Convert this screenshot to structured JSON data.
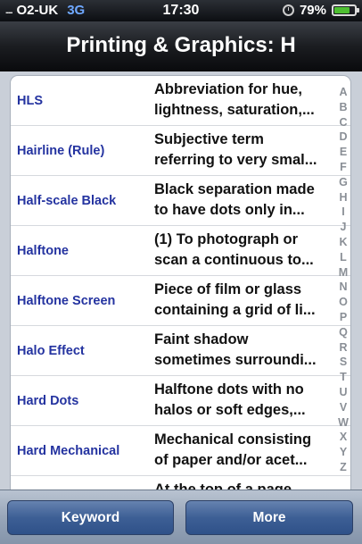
{
  "status_bar": {
    "signal": ".....",
    "carrier": "O2-UK",
    "network": "3G",
    "time": "17:30",
    "battery": "79%",
    "battery_level": 0.79
  },
  "nav": {
    "title": "Printing & Graphics: H"
  },
  "rows": [
    {
      "term": "HLS",
      "def1": "Abbreviation for hue,",
      "def2": "lightness, saturation,..."
    },
    {
      "term": "Hairline (Rule)",
      "def1": "Subjective term",
      "def2": "referring to very smal..."
    },
    {
      "term": "Half-scale Black",
      "def1": "Black separation made",
      "def2": "to have dots only in..."
    },
    {
      "term": "Halftone",
      "def1": "(1) To photograph or",
      "def2": "scan a continuous to..."
    },
    {
      "term": "Halftone Screen",
      "def1": "Piece of film or glass",
      "def2": "containing a grid of li..."
    },
    {
      "term": "Halo Effect",
      "def1": "Faint shadow",
      "def2": "sometimes surroundi..."
    },
    {
      "term": "Hard Dots",
      "def1": "Halftone dots with no",
      "def2": "halos or soft edges,..."
    },
    {
      "term": "Hard Mechanical",
      "def1": "Mechanical consisting",
      "def2": "of paper and/or acet..."
    },
    {
      "term": "",
      "def1": "At the top of a page,",
      "def2": ""
    }
  ],
  "index_letters": [
    "A",
    "B",
    "C",
    "D",
    "E",
    "F",
    "G",
    "H",
    "I",
    "J",
    "K",
    "L",
    "M",
    "N",
    "O",
    "P",
    "Q",
    "R",
    "S",
    "T",
    "U",
    "V",
    "W",
    "X",
    "Y",
    "Z"
  ],
  "toolbar": {
    "keyword_label": "Keyword",
    "more_label": "More"
  }
}
